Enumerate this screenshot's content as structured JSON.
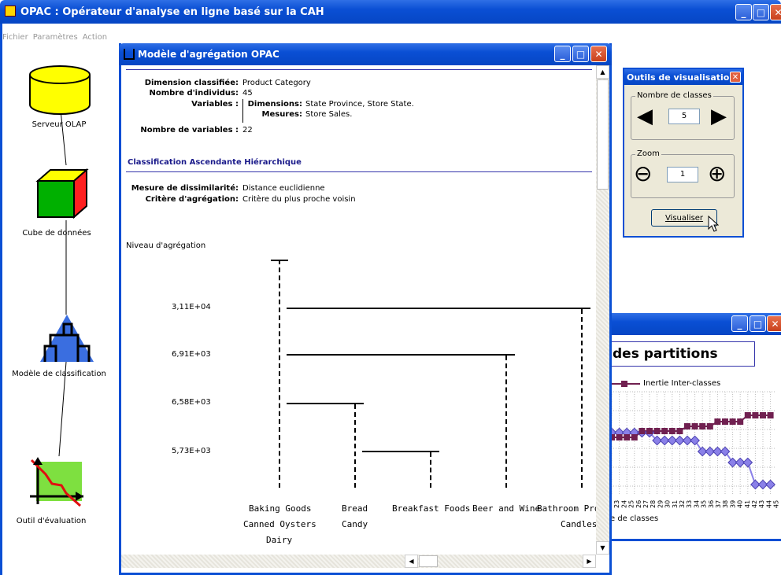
{
  "app": {
    "title": "OPAC : Opérateur d'analyse en ligne basé sur la CAH",
    "menu": [
      "Fichier",
      "Paramètres",
      "Action"
    ],
    "min": "_",
    "max": "□",
    "close": "✕"
  },
  "nodes": [
    {
      "label": "Serveur OLAP"
    },
    {
      "label": "Cube de données"
    },
    {
      "label": "Modèle de classification"
    },
    {
      "label": "Outil d'évaluation"
    }
  ],
  "model": {
    "title": "Modèle d'agrégation OPAC",
    "info": {
      "dim_label": "Dimension classifiée:",
      "dim_value": "Product Category",
      "n_label": "Nombre d'individus:",
      "n_value": "45",
      "var_label": "Variables :",
      "dims_label": "Dimensions:",
      "dims_value": "State Province, Store State.",
      "mes_label": "Mesures:",
      "mes_value": "Store Sales.",
      "nvar_label": "Nombre de variables :",
      "nvar_value": "22"
    },
    "section": "Classification Ascendante Hiérarchique",
    "method": {
      "dis_label": "Mesure de dissimilarité:",
      "dis_value": "Distance euclidienne",
      "agg_label": "Critère d'agrégation:",
      "agg_value": "Critère du plus proche voisin"
    },
    "axis_label": "Niveau d'agrégation",
    "levels": [
      "3,11E+04",
      "6,91E+03",
      "6,58E+03",
      "5,73E+03"
    ],
    "categories": {
      "baking": "Baking Goods",
      "oysters": "Canned Oysters",
      "dairy": "Dairy",
      "bread": "Bread",
      "candy": "Candy",
      "breakfast": "Breakfast Foods",
      "beer": "Beer and Wine",
      "bathroom": "Bathroom Pro",
      "candles": "Candles"
    }
  },
  "tools": {
    "title": "Outils de visualisation",
    "classes_group": "Nombre de classes",
    "classes_value": "5",
    "zoom_group": "Zoom",
    "zoom_value": "1",
    "visualize": "Visualiser",
    "left": "◀",
    "right": "▶",
    "minus": "⊖",
    "plus": "⊕"
  },
  "chart": {
    "title_partial": "des partitions",
    "legend": "Inertie Inter-classes",
    "xlabel_partial": "e de classes",
    "xticks": [
      "22",
      "23",
      "24",
      "25",
      "26",
      "27",
      "28",
      "29",
      "30",
      "31",
      "32",
      "33",
      "34",
      "35",
      "36",
      "37",
      "38",
      "39",
      "40",
      "41",
      "42",
      "43",
      "44",
      "45"
    ]
  }
}
